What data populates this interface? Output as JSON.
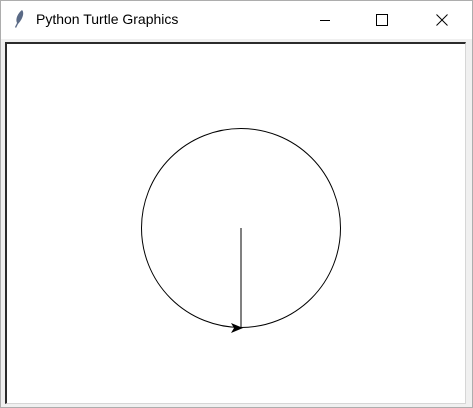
{
  "window": {
    "title": "Python Turtle Graphics",
    "controls": {
      "minimize_icon": "minimize-icon",
      "maximize_icon": "maximize-icon",
      "close_icon": "close-icon"
    },
    "app_icon": "feather-icon"
  },
  "canvas": {
    "background_color": "#ffffff",
    "pen_color": "#000000",
    "shapes": [
      "circle",
      "line"
    ],
    "turtle_icon": "arrow-cursor-icon"
  }
}
